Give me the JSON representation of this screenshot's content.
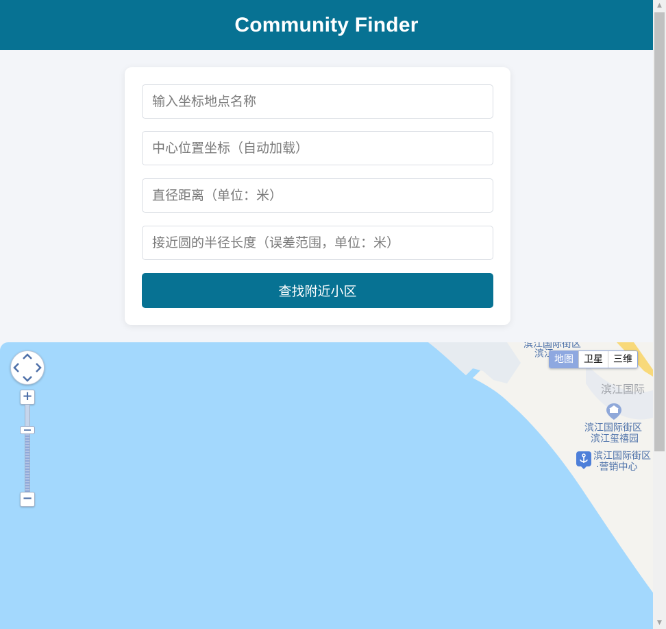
{
  "header": {
    "title": "Community Finder"
  },
  "form": {
    "location_name": {
      "placeholder": "输入坐标地点名称",
      "value": ""
    },
    "center_coords": {
      "placeholder": "中心位置坐标（自动加载）",
      "value": ""
    },
    "diameter": {
      "placeholder": "直径距离（单位：米）",
      "value": ""
    },
    "radius_tolerance": {
      "placeholder": "接近圆的半径长度（误差范围，单位：米）",
      "value": ""
    },
    "submit_label": "查找附近小区"
  },
  "map": {
    "map_types": [
      {
        "label": "地图",
        "active": true
      },
      {
        "label": "卫星",
        "active": false
      },
      {
        "label": "三维",
        "active": false
      }
    ],
    "zoom_in": "+",
    "zoom_out": "−",
    "pois": {
      "top_cut": "滨江国际街区",
      "top_cut2": "滨江",
      "area_label": "滨江国际",
      "poi1_line1": "滨江国际街区",
      "poi1_line2": "滨江玺禧园",
      "poi2_line1": "滨江国际街区",
      "poi2_line2": "·营销中心"
    },
    "colors": {
      "water": "#a3d8fd",
      "land": "#f4f3ef",
      "header": "#077293"
    }
  }
}
